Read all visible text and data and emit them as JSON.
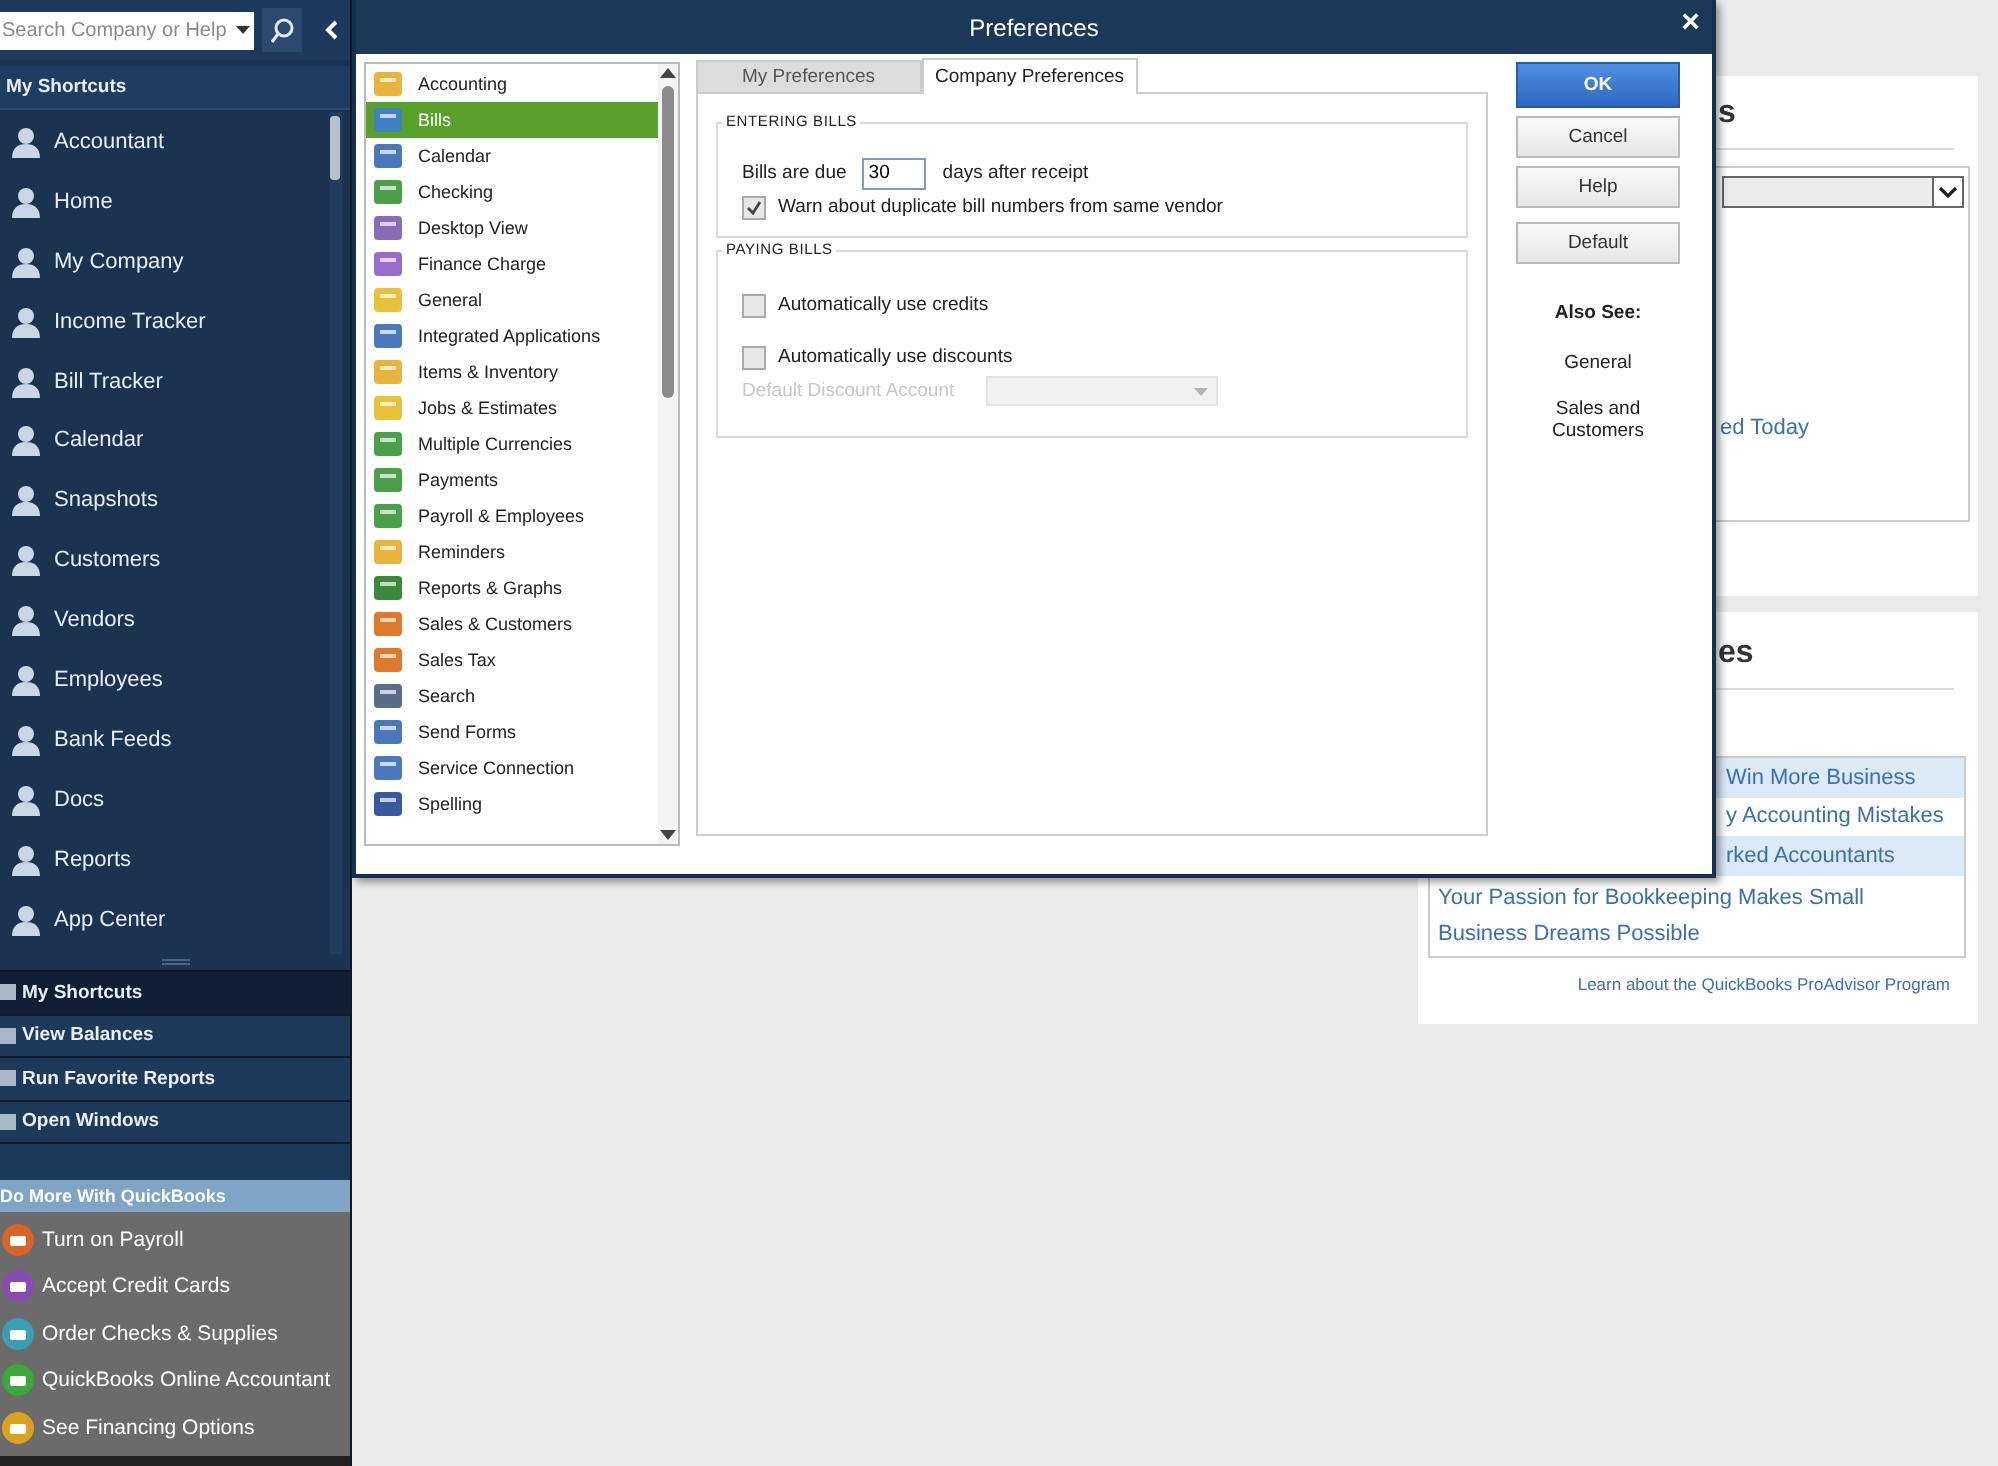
{
  "search": {
    "placeholder": "Search Company or Help"
  },
  "shortcuts": {
    "header": "My Shortcuts",
    "items": [
      {
        "label": "Accountant"
      },
      {
        "label": "Home"
      },
      {
        "label": "My Company"
      },
      {
        "label": "Income Tracker"
      },
      {
        "label": "Bill Tracker"
      },
      {
        "label": "Calendar"
      },
      {
        "label": "Snapshots"
      },
      {
        "label": "Customers"
      },
      {
        "label": "Vendors"
      },
      {
        "label": "Employees"
      },
      {
        "label": "Bank Feeds"
      },
      {
        "label": "Docs"
      },
      {
        "label": "Reports"
      },
      {
        "label": "App Center"
      }
    ]
  },
  "nav": [
    {
      "label": "My Shortcuts",
      "selected": true
    },
    {
      "label": "View Balances",
      "selected": false
    },
    {
      "label": "Run Favorite Reports",
      "selected": false
    },
    {
      "label": "Open Windows",
      "selected": false
    }
  ],
  "do_more": {
    "header": "Do More With QuickBooks",
    "items": [
      {
        "label": "Turn on Payroll",
        "color": "#d9642a"
      },
      {
        "label": "Accept Credit Cards",
        "color": "#8a4bb0"
      },
      {
        "label": "Order Checks & Supplies",
        "color": "#3a9fb5"
      },
      {
        "label": "QuickBooks Online Accountant",
        "color": "#3aa83a"
      },
      {
        "label": "See Financing Options",
        "color": "#d9a21f"
      }
    ]
  },
  "background": {
    "panel_1": {
      "title": "s",
      "link": "ed Today"
    },
    "panel_2": {
      "title": "es",
      "rows": [
        "Win More Business",
        "y Accounting Mistakes",
        "rked Accountants",
        "Your Passion for Bookkeeping Makes Small Business Dreams Possible"
      ],
      "footer_link": "Learn about the QuickBooks ProAdvisor Program"
    }
  },
  "dialog": {
    "title": "Preferences",
    "close": "×",
    "categories": [
      {
        "label": "Accounting",
        "selected": false
      },
      {
        "label": "Bills",
        "selected": true
      },
      {
        "label": "Calendar",
        "selected": false
      },
      {
        "label": "Checking",
        "selected": false
      },
      {
        "label": "Desktop View",
        "selected": false
      },
      {
        "label": "Finance Charge",
        "selected": false
      },
      {
        "label": "General",
        "selected": false
      },
      {
        "label": "Integrated Applications",
        "selected": false
      },
      {
        "label": "Items & Inventory",
        "selected": false
      },
      {
        "label": "Jobs & Estimates",
        "selected": false
      },
      {
        "label": "Multiple Currencies",
        "selected": false
      },
      {
        "label": "Payments",
        "selected": false
      },
      {
        "label": "Payroll & Employees",
        "selected": false
      },
      {
        "label": "Reminders",
        "selected": false
      },
      {
        "label": "Reports & Graphs",
        "selected": false
      },
      {
        "label": "Sales & Customers",
        "selected": false
      },
      {
        "label": "Sales Tax",
        "selected": false
      },
      {
        "label": "Search",
        "selected": false
      },
      {
        "label": "Send Forms",
        "selected": false
      },
      {
        "label": "Service Connection",
        "selected": false
      },
      {
        "label": "Spelling",
        "selected": false
      }
    ],
    "tabs": [
      {
        "label": "My Preferences",
        "selected": false
      },
      {
        "label": "Company Preferences",
        "selected": true
      }
    ],
    "sections": [
      {
        "title": "ENTERING BILLS",
        "rows": [
          {
            "kind": "due",
            "label": "Bills are due",
            "value": "30",
            "suffix": "days after receipt"
          },
          {
            "kind": "checkbox",
            "label": "Warn about duplicate bill numbers from same vendor",
            "checked": true
          }
        ]
      },
      {
        "title": "PAYING BILLS",
        "rows": [
          {
            "kind": "checkbox",
            "label": "Automatically use credits",
            "checked": false
          },
          {
            "kind": "checkbox",
            "label": "Automatically use discounts",
            "checked": false
          },
          {
            "kind": "select",
            "label": "Default Discount Account",
            "disabled": true
          }
        ]
      }
    ],
    "buttons": [
      {
        "label": "OK",
        "kind": "primary"
      },
      {
        "label": "Cancel",
        "kind": "normal"
      },
      {
        "label": "Help",
        "kind": "normal"
      },
      {
        "label": "Default",
        "kind": "normal"
      }
    ],
    "also_see": {
      "title": "Also See:",
      "links": [
        "General",
        "Sales and Customers"
      ]
    }
  }
}
